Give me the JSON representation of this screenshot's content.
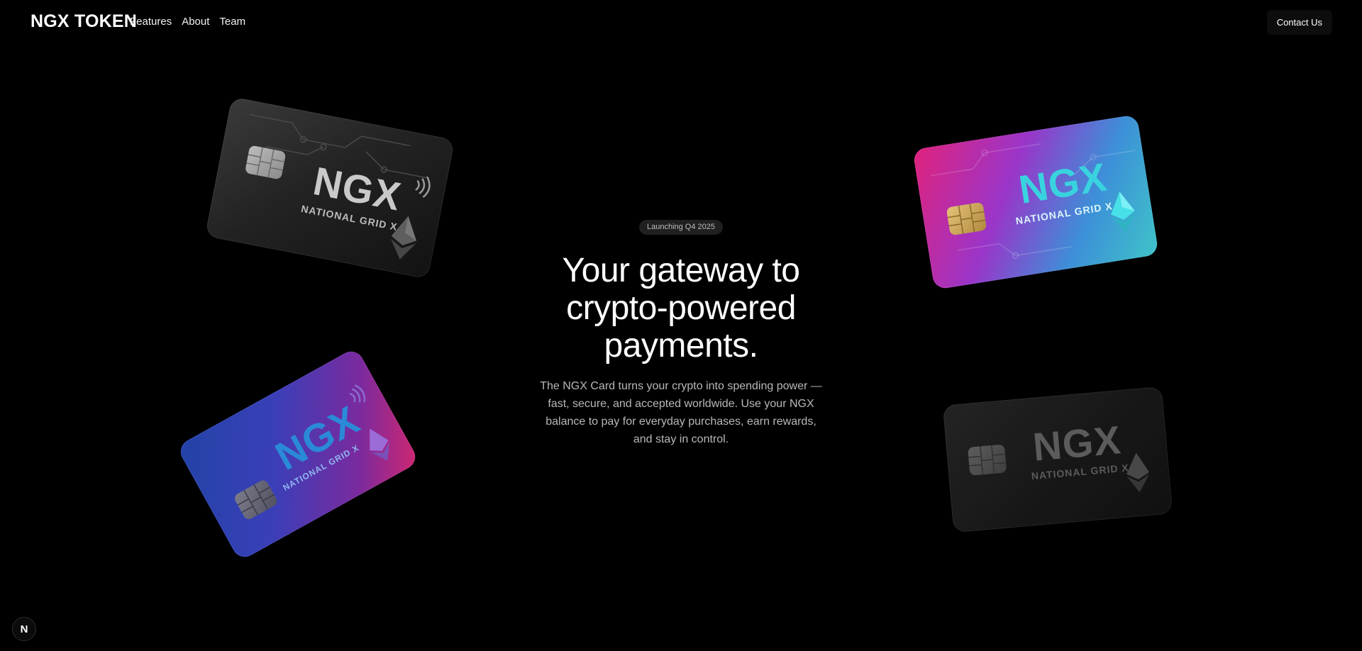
{
  "header": {
    "brand": "NGX TOKEN",
    "links": [
      {
        "label": "Features"
      },
      {
        "label": "About"
      },
      {
        "label": "Team"
      }
    ],
    "contact_label": "Contact Us"
  },
  "hero": {
    "badge": "Launching Q4 2025",
    "headline_lines": [
      "Your gateway to",
      "crypto-powered",
      "payments."
    ],
    "description_lines": [
      "The NGX Card turns your crypto into spending power —",
      "fast, secure, and accepted worldwide. Use your NGX",
      "balance to pay for everyday purchases, earn rewards,",
      "and stay in control."
    ]
  },
  "cards": [
    {
      "logo": "NGX",
      "subtitle": "NATIONAL GRID X",
      "style": "dark"
    },
    {
      "logo": "NGX",
      "subtitle": "NATIONAL GRID X",
      "style": "pink-cyan"
    },
    {
      "logo": "NGX",
      "subtitle": "NATIONAL GRID X",
      "style": "blue-pink"
    },
    {
      "logo": "NGX",
      "subtitle": "NATIONAL GRID X",
      "style": "dark-faded"
    }
  ],
  "dev_badge": {
    "letter": "N",
    "icon": "nextjs-icon"
  },
  "colors": {
    "background": "#000000",
    "text": "#ffffff",
    "muted_text": "#b8b8b8",
    "badge_bg": "#202020",
    "card_cyan": "#39d3e0",
    "card_pink": "#e0227c"
  }
}
